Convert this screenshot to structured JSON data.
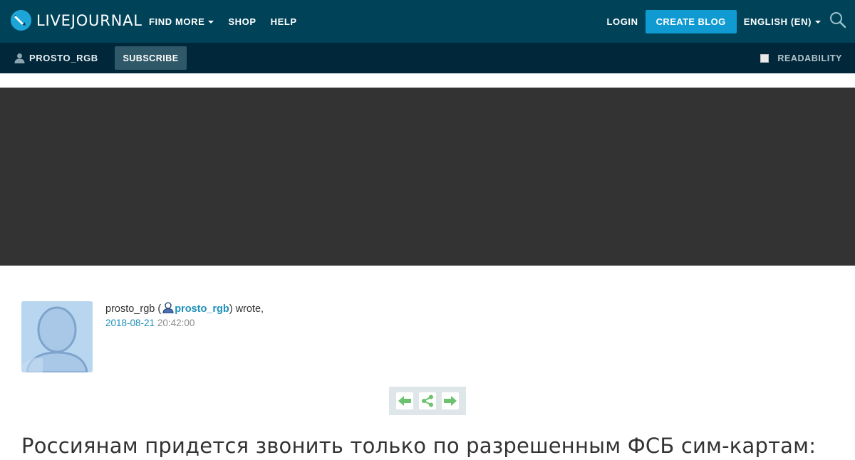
{
  "header": {
    "logo_text": "LIVEJOURNAL",
    "nav": [
      {
        "label": "FIND MORE",
        "has_dropdown": true
      },
      {
        "label": "SHOP",
        "has_dropdown": false
      },
      {
        "label": "HELP",
        "has_dropdown": false
      }
    ],
    "login_label": "LOGIN",
    "create_blog_label": "CREATE BLOG",
    "language_label": "ENGLISH (EN)",
    "search_icon": "search-icon"
  },
  "subheader": {
    "username": "PROSTO_RGB",
    "subscribe_label": "SUBSCRIBE",
    "readability_label": "READABILITY",
    "readability_checked": false
  },
  "post": {
    "author_name": "prosto_rgb",
    "author_link": "prosto_rgb",
    "wrote_text": "wrote,",
    "date": "2018-08-21",
    "time": "20:42:00",
    "title": "Россиянам придется звонить только по разрешенным ФСБ сим-картам:"
  },
  "share_controls": [
    "arrow-left-icon",
    "share-icon",
    "arrow-right-icon"
  ],
  "colors": {
    "topbar": "#004359",
    "subbar": "#00283a",
    "accent": "#0f9bd2",
    "link": "#1d8fb9",
    "banner": "#333333",
    "share_green": "#6cc26e"
  }
}
